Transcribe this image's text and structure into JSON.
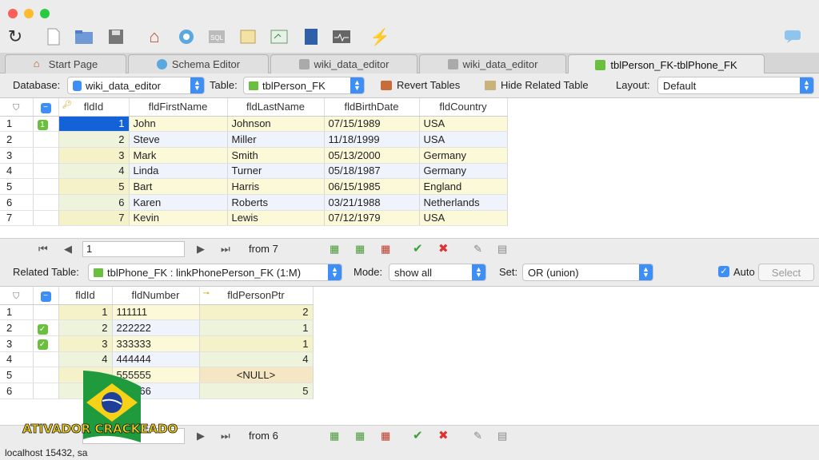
{
  "tabs": [
    {
      "label": "Start Page",
      "icon": "home-icon"
    },
    {
      "label": "Schema Editor",
      "icon": "schema-icon"
    },
    {
      "label": "wiki_data_editor",
      "icon": "sql-icon"
    },
    {
      "label": "wiki_data_editor",
      "icon": "sql-icon"
    },
    {
      "label": "tblPerson_FK-tblPhone_FK",
      "icon": "table-icon"
    }
  ],
  "top_bar": {
    "database_label": "Database:",
    "database_value": "wiki_data_editor",
    "table_label": "Table:",
    "table_value": "tblPerson_FK",
    "revert_label": "Revert Tables",
    "hide_label": "Hide Related Table",
    "layout_label": "Layout:",
    "layout_value": "Default"
  },
  "person_table": {
    "columns": [
      "fldId",
      "fldFirstName",
      "fldLastName",
      "fldBirthDate",
      "fldCountry"
    ],
    "rows": [
      [
        "1",
        "John",
        "Johnson",
        "07/15/1989",
        "USA"
      ],
      [
        "2",
        "Steve",
        "Miller",
        "11/18/1999",
        "USA"
      ],
      [
        "3",
        "Mark",
        "Smith",
        "05/13/2000",
        "Germany"
      ],
      [
        "4",
        "Linda",
        "Turner",
        "05/18/1987",
        "Germany"
      ],
      [
        "5",
        "Bart",
        "Harris",
        "06/15/1985",
        "England"
      ],
      [
        "6",
        "Karen",
        "Roberts",
        "03/21/1988",
        "Netherlands"
      ],
      [
        "7",
        "Kevin",
        "Lewis",
        "07/12/1979",
        "USA"
      ]
    ],
    "row_numbers": [
      "1",
      "2",
      "3",
      "4",
      "5",
      "6",
      "7"
    ],
    "first_mark": "1"
  },
  "nav1": {
    "page": "1",
    "from": "from 7"
  },
  "related_bar": {
    "related_label": "Related Table:",
    "related_value": "tblPhone_FK : linkPhonePerson_FK (1:M)",
    "mode_label": "Mode:",
    "mode_value": "show all",
    "set_label": "Set:",
    "set_value": "OR (union)",
    "auto_label": "Auto",
    "select_label": "Select"
  },
  "phone_table": {
    "columns": [
      "fldId",
      "fldNumber",
      "fldPersonPtr"
    ],
    "rows": [
      [
        "1",
        "111111",
        "2"
      ],
      [
        "2",
        "222222",
        "1"
      ],
      [
        "3",
        "333333",
        "1"
      ],
      [
        "4",
        "444444",
        "4"
      ],
      [
        "",
        "555555",
        "<NULL>"
      ],
      [
        "",
        "666666",
        "5"
      ]
    ],
    "row_numbers": [
      "1",
      "2",
      "3",
      "4",
      "5",
      "6"
    ],
    "checked": [
      false,
      true,
      true,
      false,
      false,
      false
    ]
  },
  "nav2": {
    "from": "from 6"
  },
  "status": "localhost 15432, sa",
  "watermark": "ATIVADOR CRACKEADO",
  "colors": {
    "accent": "#3d8ef7",
    "selected": "#1462d8",
    "odd_row": "#fcf9d8",
    "even_row": "#eef3fc"
  }
}
